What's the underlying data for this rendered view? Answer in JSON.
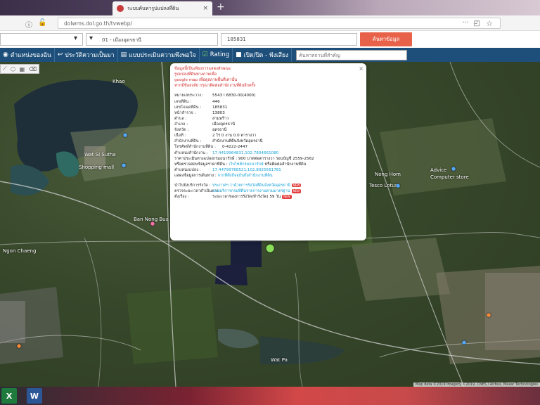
{
  "browser": {
    "tab_title": "ระบบค้นหารูปแปลงที่ดิน",
    "tab_close": "×",
    "new_tab": "+",
    "url": "dolwms.dol.go.th/tvwebp/",
    "url_ellipsis": "···"
  },
  "search": {
    "select_a_value": "",
    "select_b_value": "01 - เมืองอุดรธานี",
    "input_value": "185831",
    "button_label": "ค้นหาข้อมูล"
  },
  "menu": {
    "items": [
      {
        "icon": "globe-icon",
        "label": "ตำแหน่งของฉัน"
      },
      {
        "icon": "history-icon",
        "label": "ประวัติความเป็นมา"
      },
      {
        "icon": "form-icon",
        "label": "แบบประเมินความพึงพอใจ"
      },
      {
        "icon": "check-icon",
        "label": "Rating"
      },
      {
        "icon": "square-icon",
        "label": "เปิด/ปิด - ฟังเสียง"
      }
    ],
    "search_placeholder": "ค้นหาสถานที่สำคัญ"
  },
  "map": {
    "labels": [
      "Khao",
      "Wat Si Sutha",
      "Shopping mall",
      "Advice",
      "Computer store",
      "Nong Hom",
      "Ban Nong Bua",
      "Tesco Lotus",
      "Wat Pa",
      "Ngon Chaeng"
    ],
    "attribution": "Map data ©2019 Imagery ©2019, CNES / Airbus, Maxar Technologies"
  },
  "popup": {
    "close": "×",
    "warning_lines": [
      "ข้อมูลนี้เป็นเพียงการแสดงลักษณะ",
      "รูปแปลงที่ดินทางภาพเพื่อ",
      "google map เพื่อดูสภาพพื้นที่เท่านั้น",
      "หากมีข้อสงสัย กรุณาติดต่อสำนักงานที่ดินอีกครั้ง"
    ],
    "fields": [
      {
        "label": "หมายเลขระวาง :",
        "value": "5543 I 6830-00(4000)"
      },
      {
        "label": "เลขที่ดิน :",
        "value": "446"
      },
      {
        "label": "เลขโฉนดที่ดิน :",
        "value": "185831"
      },
      {
        "label": "หน้าสำรวจ :",
        "value": "13803"
      },
      {
        "label": "ตำบล :",
        "value": "สามพร้าว"
      },
      {
        "label": "อำเภอ :",
        "value": "เมืองอุดรธานี"
      },
      {
        "label": "จังหวัด :",
        "value": "อุดรธานี"
      },
      {
        "label": "เนื้อที่ :",
        "value": "2 ไร่ 0 งาน 0.0 ตารางวา"
      },
      {
        "label": "สำนักงานที่ดิน :",
        "value": "สำนักงานที่ดินจังหวัดอุดรธานี"
      },
      {
        "label": "โทรศัพท์สำนักงานที่ดิน :",
        "value": "0-4222-2447"
      }
    ],
    "coords_label": "ตำแหน่งสำนักงาน :",
    "coords_value": "17.4419964831,102.7804661080",
    "price_label": "ราคาประเมินทางแปลงกรมธนารักษ์ :",
    "price_value": "900 บาทต่อตารางวา รอบบัญชี 2559-2562",
    "land_info_label": "หรือตรวจสอบข้อมูลราคาที่ดิน :",
    "land_info_link": "เว็บไซต์กรมธนารักษ์",
    "land_info_suffix": "หรือติดต่อสำนักงานที่ดิน",
    "parcel_pos_label": "ตำแหน่งแปลง :",
    "parcel_pos_value": "17.44799768521,102.8025561781",
    "nav_label": "แสดงข้อมูลการเดินทาง :",
    "nav_link": "จากที่ตั้งปัจจุบันถึงสำนักงานที่ดิน",
    "bottom_rows": [
      {
        "label": "นำไปยังบริการรังวัด :",
        "value": "ประกาศฯ ว่าด้วยการรังวัดที่ดินจังหวัดอุดรธานี",
        "tag": "NEW"
      },
      {
        "label": "ตรวจระยะเวลาดำเนินการ :",
        "value": "แบบบริการกรมที่ดินรายการงานตามมาตรฐาน",
        "tag": "NEW"
      },
      {
        "label": "ตั้งเรื่อง :",
        "value": "ระยะเวลาของการรังวัด(ทำรังวัด) 59 วัน",
        "tag": "NEW"
      }
    ]
  },
  "taskbar": {
    "apps": [
      {
        "icon": "excel-icon",
        "label": "X"
      },
      {
        "icon": "word-icon",
        "label": "W"
      }
    ]
  }
}
